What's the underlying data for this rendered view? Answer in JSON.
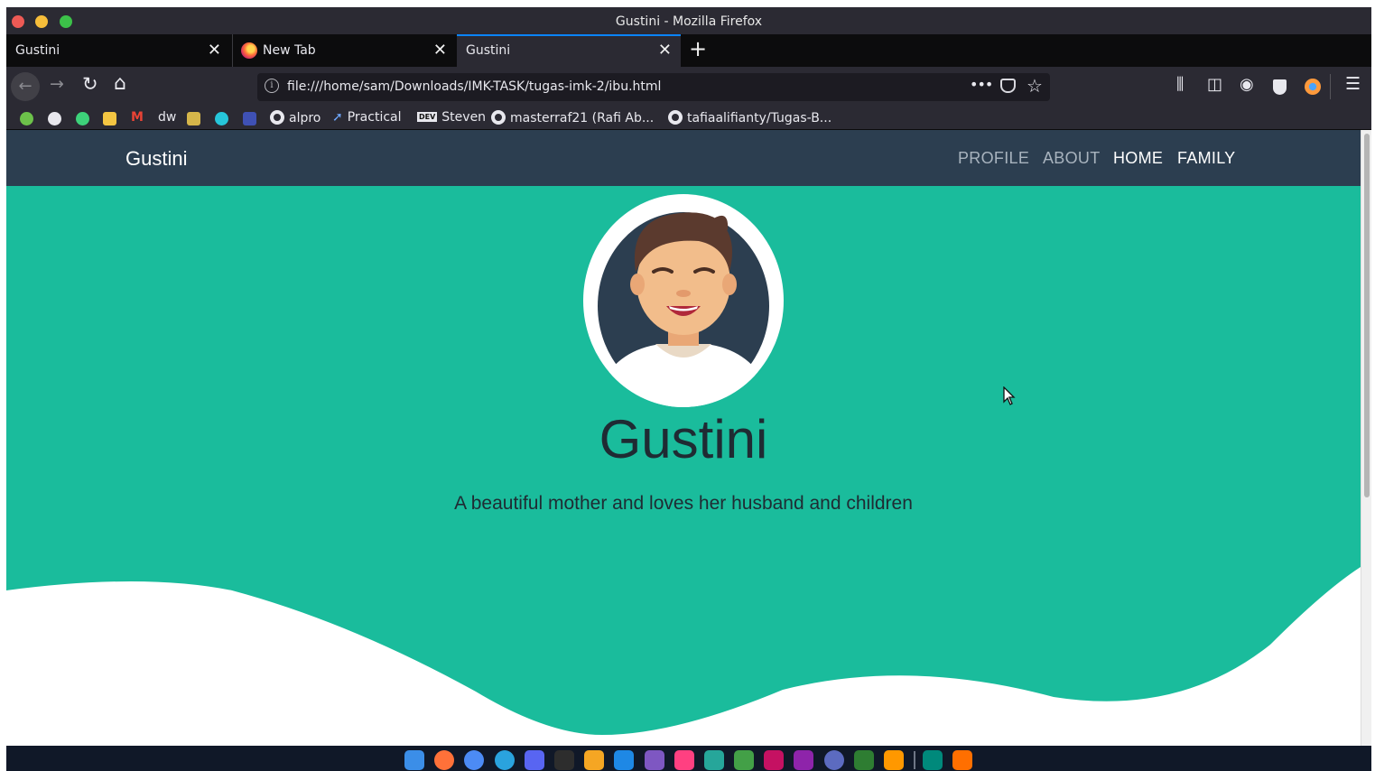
{
  "window": {
    "title": "Gustini - Mozilla Firefox"
  },
  "tabs": [
    {
      "label": "Gustini",
      "close": "✕"
    },
    {
      "label": "New Tab",
      "close": "✕"
    },
    {
      "label": "Gustini",
      "close": "✕",
      "active": true
    }
  ],
  "toolbar": {
    "new_tab": "+",
    "back": "←",
    "forward": "→",
    "reload": "↻",
    "home": "⌂",
    "url": "file:///home/sam/Downloads/IMK-TASK/tugas-imk-2/ibu.html",
    "page_actions": "•••",
    "star": "☆",
    "library": "⫼",
    "sidebar": "◫",
    "account": "◉",
    "menu": "☰"
  },
  "bookmarks": {
    "items": [
      {
        "label": "dw"
      },
      {
        "label": "alpro"
      },
      {
        "label": "Practical"
      },
      {
        "label": "Steven",
        "badge": "DEV"
      },
      {
        "label": "masterraf21 (Rafi Ab..."
      },
      {
        "label": "tafiaalifianty/Tugas-B..."
      }
    ],
    "icon_colors": [
      "#6cc24a",
      "#e8e8ee",
      "#3dd27a",
      "#f4c542",
      "#ea4335",
      "#d6b64a",
      "#26c6da",
      "#3f51b5"
    ]
  },
  "page": {
    "brand": "Gustini",
    "nav_links": [
      "PROFILE",
      "ABOUT",
      "HOME",
      "FAMILY"
    ],
    "hero_name": "Gustini",
    "hero_subtitle": "A beautiful mother and loves her husband and children",
    "colors": {
      "primary": "#1abc9c",
      "navbar": "#2c3e50",
      "text_dark": "#1f2b33"
    }
  },
  "dock": {
    "icon_colors": [
      "#3b8ee8",
      "#ff7139",
      "#4c8bf5",
      "#2aa3de",
      "#5865f2",
      "#2d2d2d",
      "#f5a623",
      "#1e88e5",
      "#7e57c2",
      "#ff4081",
      "#26a69a",
      "#43a047",
      "#c51162",
      "#8e24aa",
      "#5c6bc0",
      "#2e7d32",
      "#ff9800",
      "#00897b",
      "#ff6f00"
    ]
  }
}
